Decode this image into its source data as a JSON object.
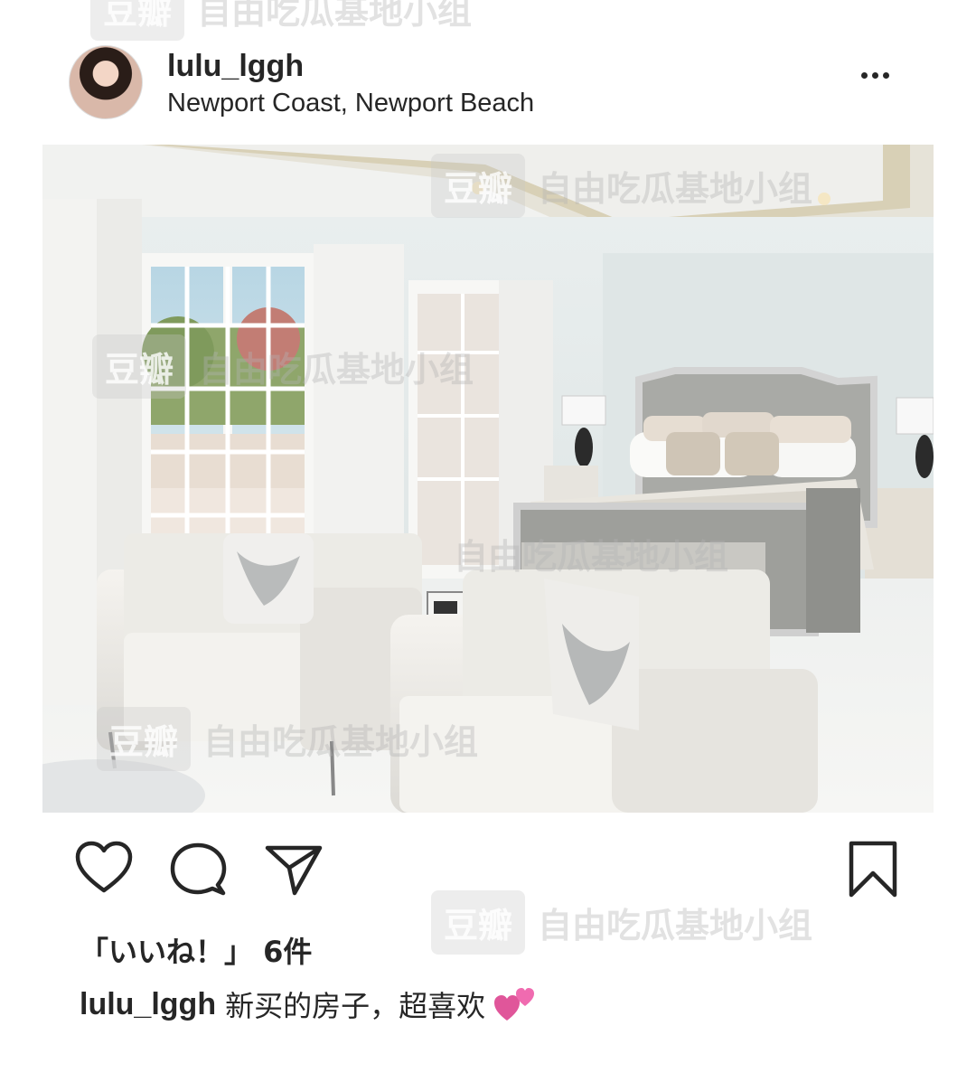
{
  "post": {
    "username": "lulu_lggh",
    "location": "Newport Coast, Newport Beach",
    "likes_text": "「いいね！」 6件",
    "caption_user": "lulu_lggh",
    "caption_text": "新买的房子，超喜欢"
  },
  "watermark": {
    "badge": "豆瓣",
    "text": "自由吃瓜基地小组"
  },
  "icons": [
    "more-icon",
    "heart-icon",
    "comment-icon",
    "share-icon",
    "bookmark-icon",
    "two-hearts-emoji"
  ],
  "colors": {
    "text": "#262626",
    "background": "#ffffff"
  }
}
